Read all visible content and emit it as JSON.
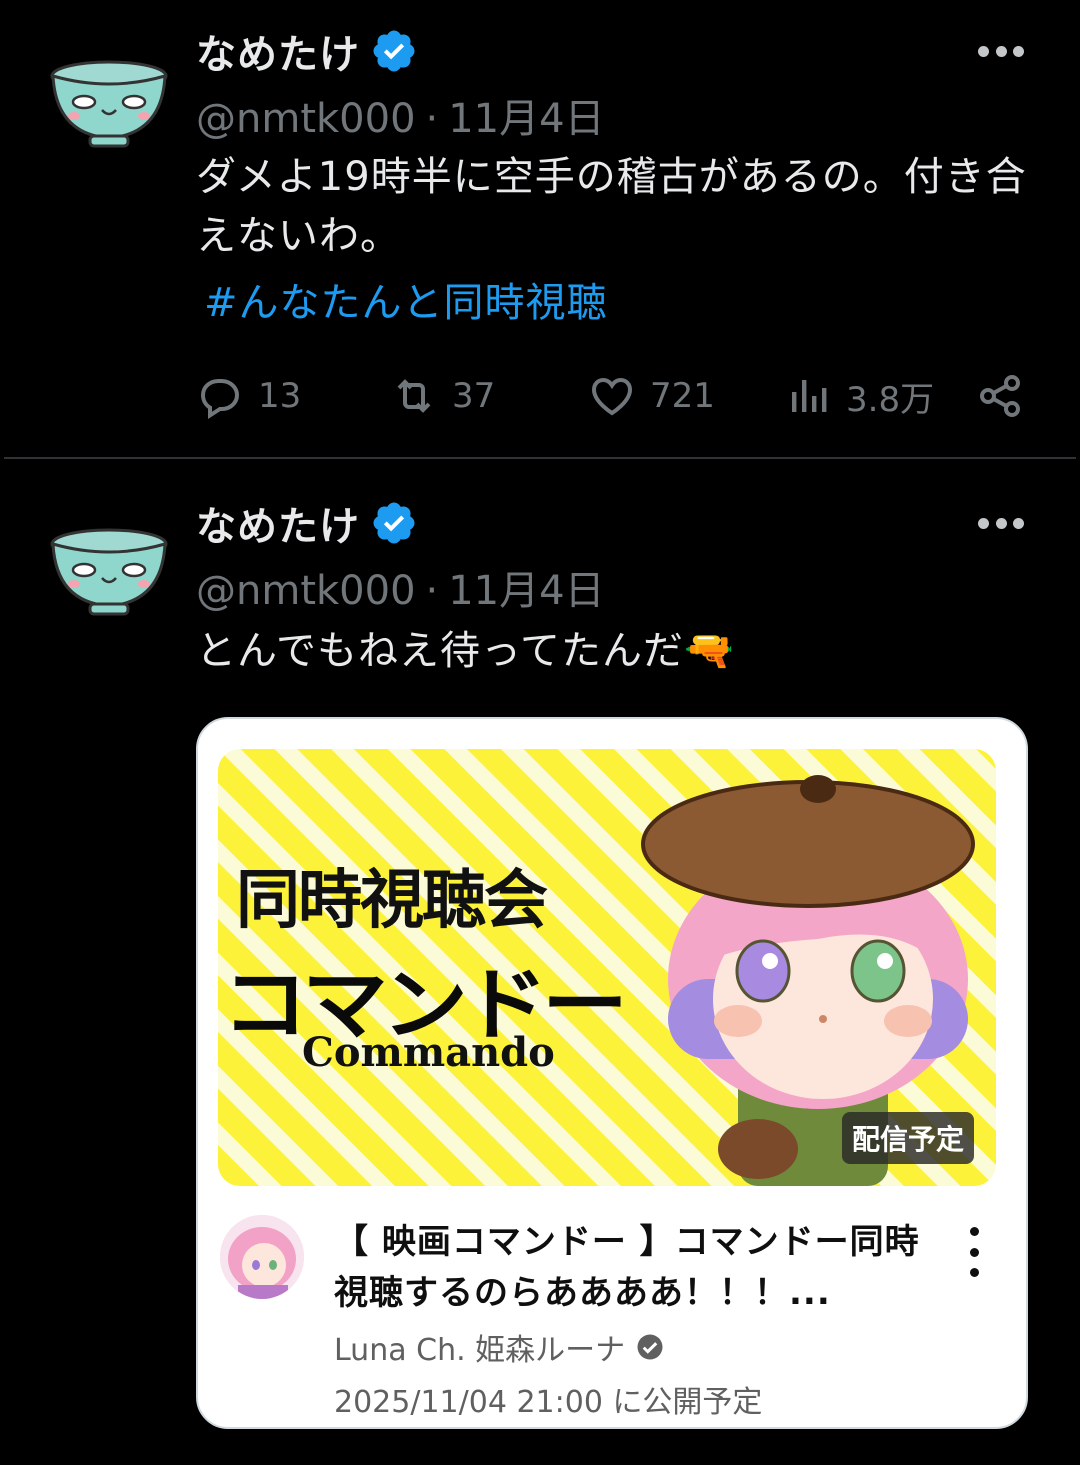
{
  "tweets": [
    {
      "display_name": "なめたけ",
      "handle": "@nmtk000",
      "separator": "·",
      "date": "11月4日",
      "text": "ダメよ19時半に空手の稽古があるの。付き合えないわ。",
      "hashtag": "#んなたんと同時視聴",
      "replies": "13",
      "reposts": "37",
      "likes": "721",
      "views": "3.8万"
    },
    {
      "display_name": "なめたけ",
      "handle": "@nmtk000",
      "separator": "·",
      "date": "11月4日",
      "text": "とんでもねえ待ってたんだ",
      "emoji": "🔫"
    }
  ],
  "card": {
    "thumb_title": "同時視聴会",
    "thumb_katakana": "コマンドー",
    "thumb_english": "Commando",
    "badge": "配信予定",
    "video_title": "【 映画コマンドー 】コマンドー同時視聴するのらああああ！！！...",
    "channel": "Luna Ch. 姫森ルーナ",
    "scheduled": "2025/11/04 21:00 に公開予定"
  },
  "icons": [
    "bowl-avatar-icon",
    "verified-badge-icon",
    "more-icon",
    "reply-icon",
    "repost-icon",
    "like-icon",
    "views-icon",
    "share-icon",
    "kebab-icon",
    "channel-verified-icon"
  ],
  "colors": {
    "background": "#000000",
    "text": "#e7e9ea",
    "muted": "#71767b",
    "link": "#1d9bf0",
    "verified": "#1d9bf0"
  }
}
